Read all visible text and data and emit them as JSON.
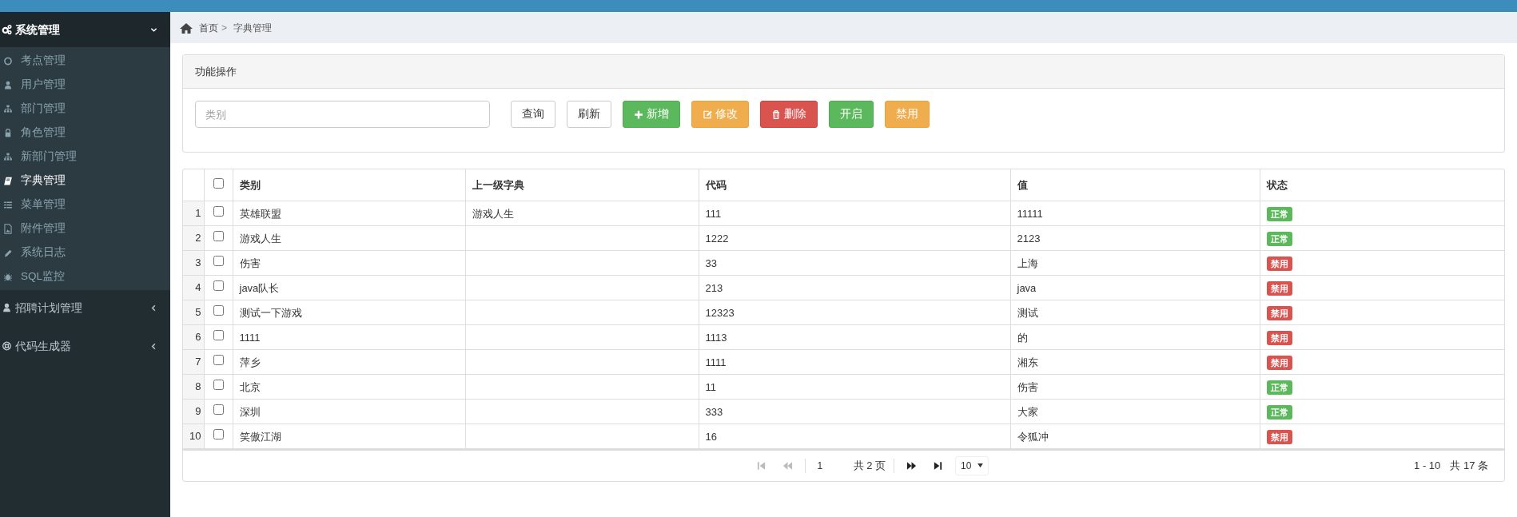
{
  "sidebar": {
    "groups": [
      {
        "label": "系统管理",
        "kind": "gears",
        "expanded": true,
        "children": [
          {
            "label": "考点管理",
            "kind": "circle",
            "selected": false
          },
          {
            "label": "用户管理",
            "kind": "user",
            "selected": false
          },
          {
            "label": "部门管理",
            "kind": "sitemap",
            "selected": false
          },
          {
            "label": "角色管理",
            "kind": "lock",
            "selected": false
          },
          {
            "label": "新部门管理",
            "kind": "sitemap",
            "selected": false
          },
          {
            "label": "字典管理",
            "kind": "book",
            "selected": true
          },
          {
            "label": "菜单管理",
            "kind": "list",
            "selected": false
          },
          {
            "label": "附件管理",
            "kind": "image",
            "selected": false
          },
          {
            "label": "系统日志",
            "kind": "pencil",
            "selected": false
          },
          {
            "label": "SQL监控",
            "kind": "bug",
            "selected": false
          }
        ]
      },
      {
        "label": "招聘计划管理",
        "kind": "user",
        "expanded": false
      },
      {
        "label": "代码生成器",
        "kind": "lifebuoy",
        "expanded": false
      }
    ]
  },
  "breadcrumb": [
    "首页",
    "字典管理"
  ],
  "breadcrumb_separator": ">",
  "panel": {
    "title": "功能操作",
    "search": {
      "placeholder": "类别"
    },
    "buttons": [
      {
        "label": "查询",
        "kind": "default"
      },
      {
        "label": "刷新",
        "kind": "default"
      },
      {
        "label": "新增",
        "kind": "success"
      },
      {
        "label": "修改",
        "kind": "warning"
      },
      {
        "label": "删除",
        "kind": "danger"
      },
      {
        "label": "开启",
        "kind": "success"
      },
      {
        "label": "禁用",
        "kind": "warning"
      }
    ]
  },
  "table": {
    "all_checked": false,
    "columns": [
      "类别",
      "上一级字典",
      "代码",
      "值",
      "状态"
    ],
    "rows": [
      {
        "index": "1",
        "checked": false,
        "cells": [
          "英雄联盟",
          "游戏人生",
          "111",
          "11111"
        ],
        "status": {
          "label": "正常",
          "kind": "normal"
        }
      },
      {
        "index": "2",
        "checked": false,
        "cells": [
          "游戏人生",
          "",
          "1222",
          "2123"
        ],
        "status": {
          "label": "正常",
          "kind": "normal"
        }
      },
      {
        "index": "3",
        "checked": false,
        "cells": [
          "伤害",
          "",
          "33",
          "上海"
        ],
        "status": {
          "label": "禁用",
          "kind": "disabled"
        }
      },
      {
        "index": "4",
        "checked": false,
        "cells": [
          "java队长",
          "",
          "213",
          "java"
        ],
        "status": {
          "label": "禁用",
          "kind": "disabled"
        }
      },
      {
        "index": "5",
        "checked": false,
        "cells": [
          "测试一下游戏",
          "",
          "12323",
          "测试"
        ],
        "status": {
          "label": "禁用",
          "kind": "disabled"
        }
      },
      {
        "index": "6",
        "checked": false,
        "cells": [
          "1111",
          "",
          "1113",
          "的"
        ],
        "status": {
          "label": "禁用",
          "kind": "disabled"
        }
      },
      {
        "index": "7",
        "checked": false,
        "cells": [
          "萍乡",
          "",
          "1111",
          "湘东"
        ],
        "status": {
          "label": "禁用",
          "kind": "disabled"
        }
      },
      {
        "index": "8",
        "checked": false,
        "cells": [
          "北京",
          "",
          "11",
          "伤害"
        ],
        "status": {
          "label": "正常",
          "kind": "normal"
        }
      },
      {
        "index": "9",
        "checked": false,
        "cells": [
          "深圳",
          "",
          "333",
          "大家"
        ],
        "status": {
          "label": "正常",
          "kind": "normal"
        }
      },
      {
        "index": "10",
        "checked": false,
        "cells": [
          "笑傲江湖",
          "",
          "16",
          "令狐冲"
        ],
        "status": {
          "label": "禁用",
          "kind": "disabled"
        }
      }
    ]
  },
  "pager": {
    "first_disabled": true,
    "prev_disabled": true,
    "next_disabled": false,
    "last_disabled": false,
    "page": "1",
    "page_total": "共 2 页",
    "page_size": "10",
    "range": "1 - 10",
    "total": "共 17 条"
  }
}
